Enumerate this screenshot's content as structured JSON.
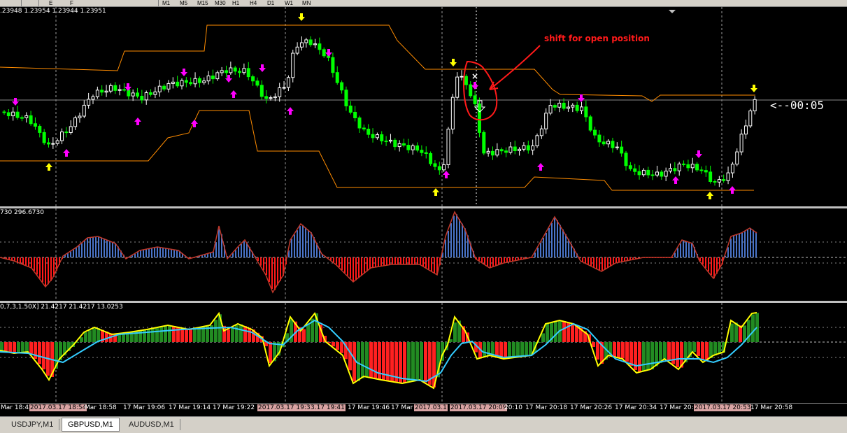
{
  "toolbar": {
    "buttons": [
      "E",
      "F",
      "M1",
      "M5",
      "M15",
      "M30",
      "H1",
      "H4",
      "D1",
      "W1",
      "MN"
    ]
  },
  "main_chart": {
    "symbol": "GBPUSD",
    "ohlc_label": ".23948 1.23954 1.23944 1.23951",
    "countdown": "<--00:05",
    "annotation": "shift for open position",
    "colors": {
      "bull": "#ffffff",
      "bear": "#00ff00",
      "channel": "#ff8c00",
      "arrow_up": "#ff00ff",
      "arrow_signal": "#ffff00",
      "annotation": "#ff1a1a"
    }
  },
  "indicator1": {
    "label": "730 296.6730",
    "colors": {
      "positive": "#4a74c8",
      "negative": "#ff1a1a",
      "line": "#c0392b"
    }
  },
  "indicator2": {
    "label": "0,7,3,1.50X] 21.4217 21.4217 13.0253",
    "colors": {
      "up": "#228b22",
      "down": "#ff2020",
      "line_fast": "#ffff00",
      "line_slow": "#33ccff"
    }
  },
  "time_axis": [
    {
      "text": "Mar 18:42",
      "hl": false
    },
    {
      "text": "2017.03.17 18:54",
      "hl": true
    },
    {
      "text": "Mar 18:58",
      "hl": false
    },
    {
      "text": "17 Mar 19:06",
      "hl": false
    },
    {
      "text": "17 Mar 19:14",
      "hl": false
    },
    {
      "text": "17 Mar 19:22",
      "hl": false
    },
    {
      "text": "2017.03.17 19:35",
      "hl": true
    },
    {
      "text": "3.17 19:41",
      "hl": true
    },
    {
      "text": "17 Mar 19:46",
      "hl": false
    },
    {
      "text": "17 Mar",
      "hl": false
    },
    {
      "text": "2017.03.1",
      "hl": true
    },
    {
      "text": "2017.03.17 20:09",
      "hl": true
    },
    {
      "text": "20:10",
      "hl": false
    },
    {
      "text": "17 Mar 20:18",
      "hl": false
    },
    {
      "text": "17 Mar 20:26",
      "hl": false
    },
    {
      "text": "17 Mar 20:34",
      "hl": false
    },
    {
      "text": "17 Mar 20:4",
      "hl": false
    },
    {
      "text": "2017.03.17 20:53",
      "hl": true
    },
    {
      "text": "17 Mar 20:58",
      "hl": false
    }
  ],
  "tabs": [
    {
      "label": "USDJPY,M1",
      "active": false
    },
    {
      "label": "GBPUSD,M1",
      "active": true
    },
    {
      "label": "AUDUSD,M1",
      "active": false
    }
  ]
}
